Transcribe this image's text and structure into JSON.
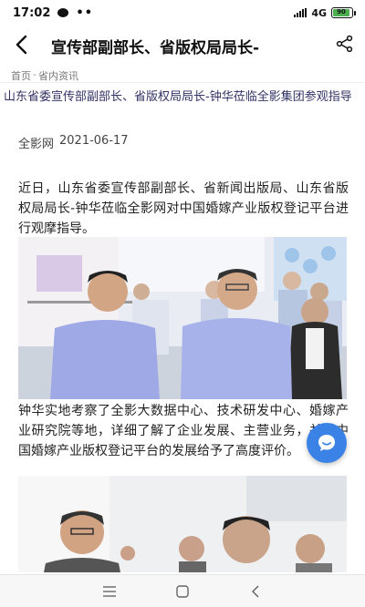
{
  "status_bar": {
    "time": "17:02",
    "network": "4G",
    "battery": "90",
    "battery_level": 0.9
  },
  "nav": {
    "title": "宣传部副部长、省版权局局长-"
  },
  "breadcrumb": {
    "home": "首页",
    "separator": "-",
    "section": "省内资讯"
  },
  "article": {
    "headline": "山东省委宣传部副部长、省版权局局长-钟华莅临全影集团参观指导",
    "source": "全影网",
    "date": "2021-06-17",
    "paragraph1": "近日，山东省委宣传部副部长、省新闻出版局、山东省版权局局长-钟华莅临全影网对中国婚嫁产业版权登记平台进行观摩指导。",
    "paragraph2": "钟华实地考察了全影大数据中心、技术研发中心、婚嫁产业研究院等地，详细了解了企业发展、主营业务，并对中国婚嫁产业版权登记平台的发展给予了高度评价。"
  },
  "colors": {
    "fab": "#3b82e6",
    "headline": "#333366"
  }
}
